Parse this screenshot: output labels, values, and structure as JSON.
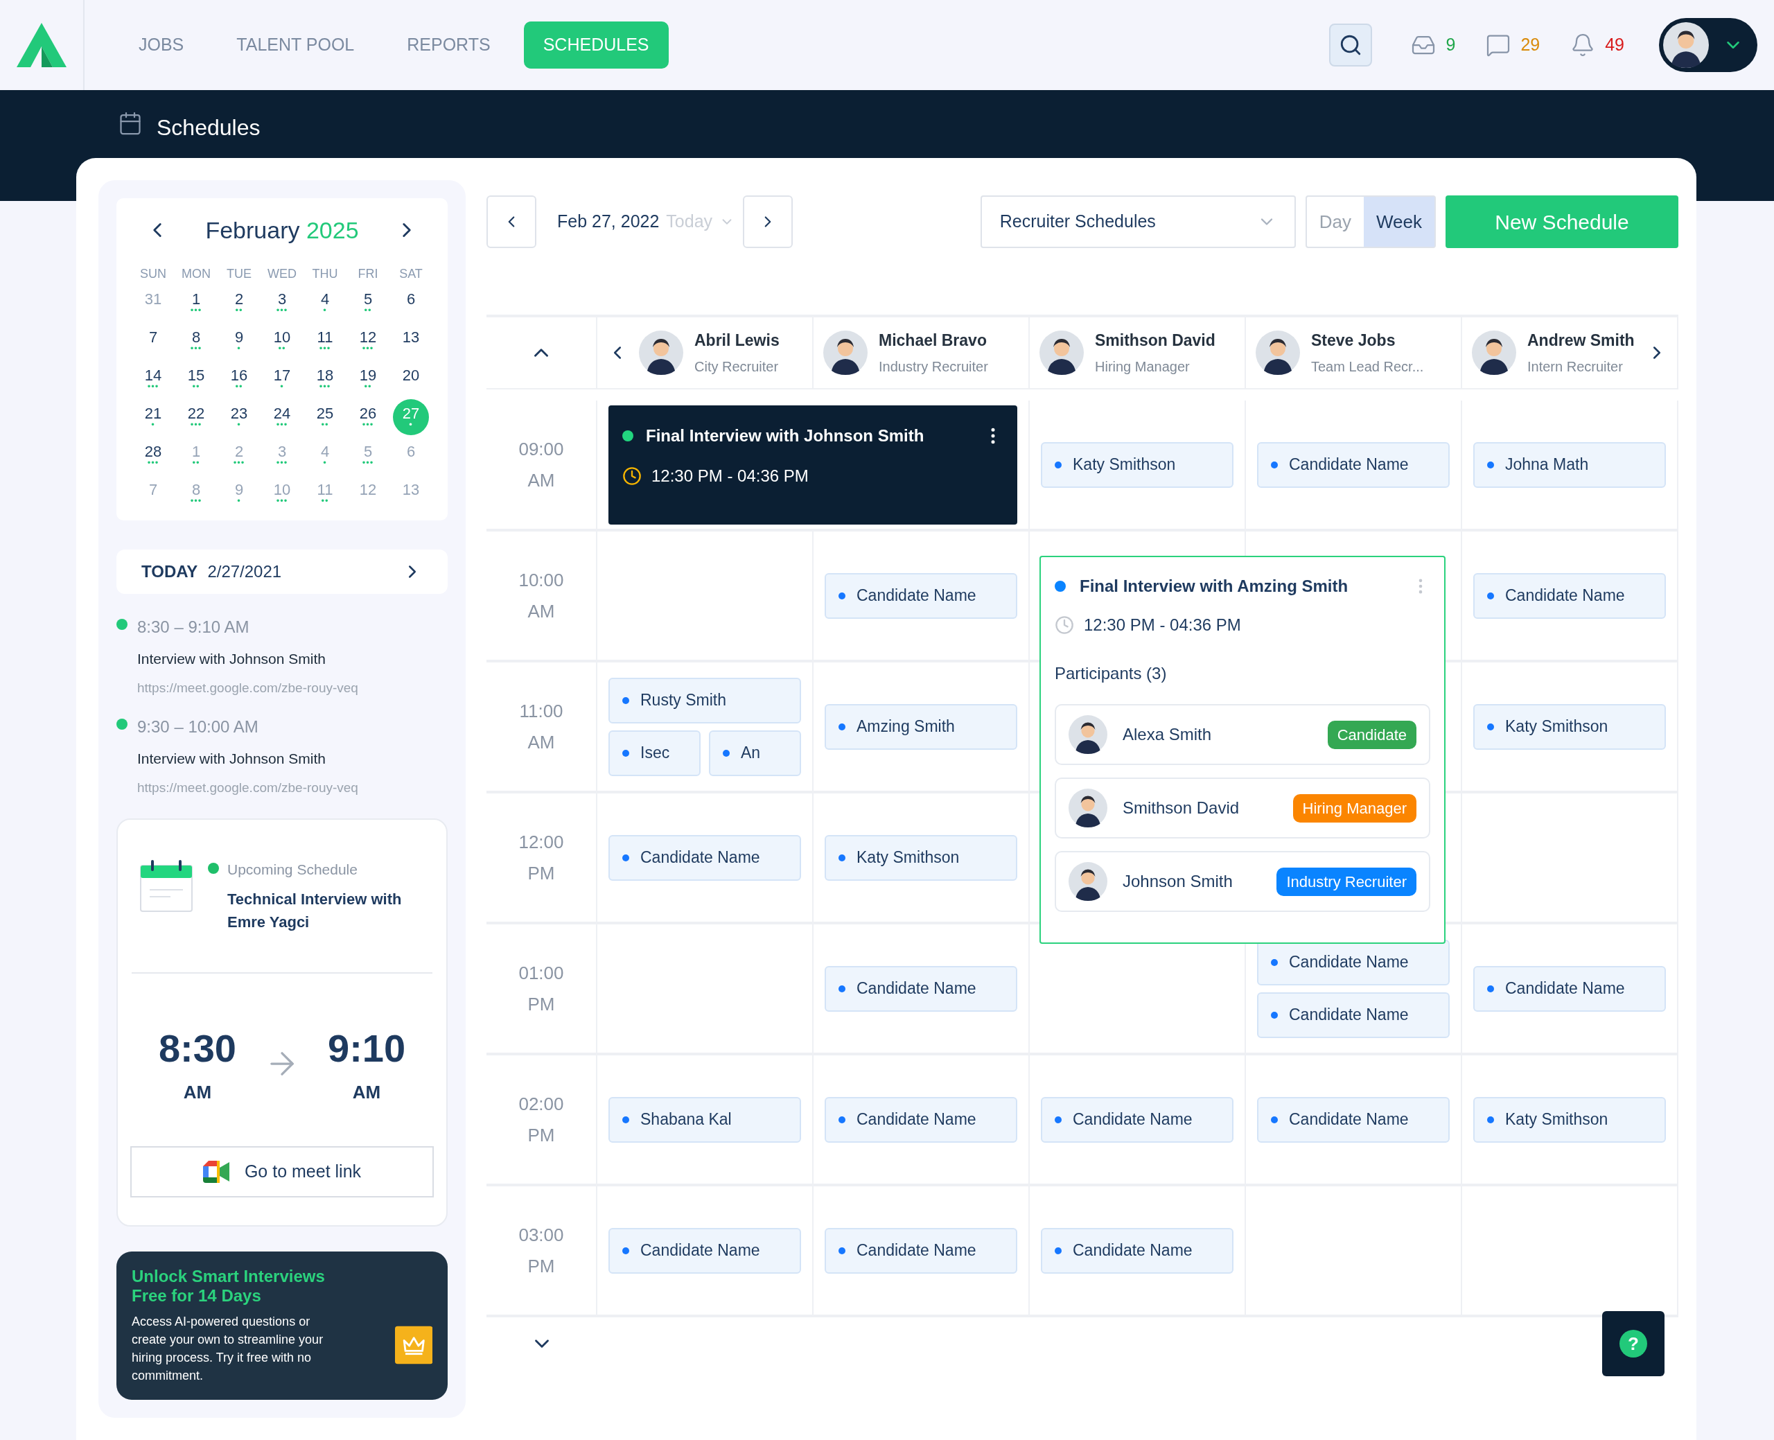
{
  "nav": {
    "items": [
      {
        "label": "JOBS",
        "selected": false
      },
      {
        "label": "TALENT POOL",
        "selected": false
      },
      {
        "label": "REPORTS",
        "selected": false
      },
      {
        "label": "SCHEDULES",
        "selected": true
      }
    ],
    "counters": [
      {
        "kind": "inbox",
        "count": "9",
        "color": "#1fa64a"
      },
      {
        "kind": "chat",
        "count": "29",
        "color": "#d98b0a"
      },
      {
        "kind": "bell",
        "count": "49",
        "color": "#d81b1b"
      }
    ]
  },
  "page_title": "Schedules",
  "mini_calendar": {
    "month": "February",
    "year": "2025",
    "weekdays": [
      "SUN",
      "MON",
      "TUE",
      "WED",
      "THU",
      "FRI",
      "SAT"
    ],
    "weeks": [
      [
        {
          "day": "31",
          "muted": true,
          "selected": false
        },
        {
          "day": "1",
          "muted": false,
          "selected": false,
          "dots": "•••"
        },
        {
          "day": "2",
          "muted": false,
          "selected": false,
          "dots": "••"
        },
        {
          "day": "3",
          "muted": false,
          "selected": false,
          "dots": "•••"
        },
        {
          "day": "4",
          "muted": false,
          "selected": false,
          "dots": "•"
        },
        {
          "day": "5",
          "muted": false,
          "selected": false,
          "dots": "••"
        },
        {
          "day": "6",
          "muted": false,
          "selected": false
        }
      ],
      [
        {
          "day": "7",
          "muted": false,
          "selected": false
        },
        {
          "day": "8",
          "muted": false,
          "selected": false,
          "dots": "•••"
        },
        {
          "day": "9",
          "muted": false,
          "selected": false,
          "dots": "•"
        },
        {
          "day": "10",
          "muted": false,
          "selected": false,
          "dots": "••"
        },
        {
          "day": "11",
          "muted": false,
          "selected": false,
          "dots": "•••"
        },
        {
          "day": "12",
          "muted": false,
          "selected": false,
          "dots": "•••"
        },
        {
          "day": "13",
          "muted": false,
          "selected": false
        }
      ],
      [
        {
          "day": "14",
          "muted": false,
          "selected": false,
          "dots": "•••"
        },
        {
          "day": "15",
          "muted": false,
          "selected": false,
          "dots": "••"
        },
        {
          "day": "16",
          "muted": false,
          "selected": false,
          "dots": "••"
        },
        {
          "day": "17",
          "muted": false,
          "selected": false,
          "dots": "•"
        },
        {
          "day": "18",
          "muted": false,
          "selected": false,
          "dots": "•••"
        },
        {
          "day": "19",
          "muted": false,
          "selected": false,
          "dots": "••"
        },
        {
          "day": "20",
          "muted": false,
          "selected": false
        }
      ],
      [
        {
          "day": "21",
          "muted": false,
          "selected": false,
          "dots": "•"
        },
        {
          "day": "22",
          "muted": false,
          "selected": false,
          "dots": "•••"
        },
        {
          "day": "23",
          "muted": false,
          "selected": false,
          "dots": "•"
        },
        {
          "day": "24",
          "muted": false,
          "selected": false,
          "dots": "•••"
        },
        {
          "day": "25",
          "muted": false,
          "selected": false,
          "dots": "••"
        },
        {
          "day": "26",
          "muted": false,
          "selected": false,
          "dots": "•••"
        },
        {
          "day": "27",
          "muted": false,
          "selected": true,
          "dots": "•"
        }
      ],
      [
        {
          "day": "28",
          "muted": false,
          "selected": false,
          "dots": "•••"
        },
        {
          "day": "1",
          "muted": true,
          "selected": false,
          "dots": "••"
        },
        {
          "day": "2",
          "muted": true,
          "selected": false,
          "dots": "•••"
        },
        {
          "day": "3",
          "muted": true,
          "selected": false,
          "dots": "•••"
        },
        {
          "day": "4",
          "muted": true,
          "selected": false,
          "dots": "•"
        },
        {
          "day": "5",
          "muted": true,
          "selected": false,
          "dots": "•••"
        },
        {
          "day": "6",
          "muted": true,
          "selected": false
        }
      ],
      [
        {
          "day": "7",
          "muted": true,
          "selected": false
        },
        {
          "day": "8",
          "muted": true,
          "selected": false,
          "dots": "•••"
        },
        {
          "day": "9",
          "muted": true,
          "selected": false,
          "dots": "•"
        },
        {
          "day": "10",
          "muted": true,
          "selected": false,
          "dots": "•••"
        },
        {
          "day": "11",
          "muted": true,
          "selected": false,
          "dots": "••"
        },
        {
          "day": "12",
          "muted": true,
          "selected": false
        },
        {
          "day": "13",
          "muted": true,
          "selected": false
        }
      ]
    ]
  },
  "today_bar": {
    "label": "TODAY",
    "date": "2/27/2021"
  },
  "agenda": [
    {
      "time": "8:30 – 9:10 AM",
      "title": "Interview with Johnson Smith",
      "link": "https://meet.google.com/zbe-rouy-veq"
    },
    {
      "time": "9:30 – 10:00 AM",
      "title": "Interview with Johnson Smith",
      "link": "https://meet.google.com/zbe-rouy-veq"
    }
  ],
  "upcoming": {
    "label": "Upcoming Schedule",
    "title_lines": [
      "Technical Interview with",
      "Emre Yagci"
    ],
    "start": {
      "time": "8:30",
      "period": "AM"
    },
    "end": {
      "time": "9:10",
      "period": "AM"
    },
    "button": "Go to meet link"
  },
  "promo": {
    "title_lines": [
      "Unlock Smart Interviews",
      "Free for 14 Days"
    ],
    "text": "Access AI-powered questions or create your own to streamline your hiring process. Try it free with no commitment."
  },
  "toolbar": {
    "date": "Feb 27, 2022",
    "today": "Today",
    "view_select": "Recruiter Schedules",
    "views": [
      {
        "label": "Day",
        "selected": false
      },
      {
        "label": "Week",
        "selected": true
      }
    ],
    "new_button": "New Schedule"
  },
  "hours": [
    {
      "time": "09:00",
      "period": "AM"
    },
    {
      "time": "10:00",
      "period": "AM"
    },
    {
      "time": "11:00",
      "period": "AM"
    },
    {
      "time": "12:00",
      "period": "PM"
    },
    {
      "time": "01:00",
      "period": "PM"
    },
    {
      "time": "02:00",
      "period": "PM"
    },
    {
      "time": "03:00",
      "period": "PM"
    }
  ],
  "recruiters": [
    {
      "name": "Abril Lewis",
      "role": "City Recruiter",
      "slots": [
        {
          "kind": "booked",
          "events": [
            {
              "kind": "highlight",
              "title": "Final Interview with Johnson Smith",
              "time": "12:30 PM - 04:36 PM"
            }
          ]
        },
        {
          "kind": "free"
        },
        {
          "kind": "booked",
          "events": [
            {
              "kind": "chip",
              "name": "Rusty Smith"
            },
            {
              "kind": "pair",
              "items": [
                {
                  "name": "Isec"
                },
                {
                  "name": "An"
                }
              ]
            }
          ]
        },
        {
          "kind": "booked",
          "events": [
            {
              "kind": "chip",
              "name": "Candidate Name"
            }
          ]
        },
        {
          "kind": "free"
        },
        {
          "kind": "booked",
          "events": [
            {
              "kind": "chip",
              "name": "Shabana Kal"
            }
          ]
        },
        {
          "kind": "booked",
          "events": [
            {
              "kind": "chip",
              "name": "Candidate Name"
            }
          ]
        }
      ]
    },
    {
      "name": "Michael Bravo",
      "role": "Industry Recruiter",
      "slots": [
        {
          "kind": "covered"
        },
        {
          "kind": "booked",
          "events": [
            {
              "kind": "chip",
              "name": "Candidate Name"
            }
          ]
        },
        {
          "kind": "booked",
          "events": [
            {
              "kind": "chip",
              "name": "Amzing Smith"
            }
          ]
        },
        {
          "kind": "booked",
          "events": [
            {
              "kind": "chip",
              "name": "Katy Smithson"
            }
          ]
        },
        {
          "kind": "booked",
          "events": [
            {
              "kind": "chip",
              "name": "Candidate Name"
            }
          ]
        },
        {
          "kind": "booked",
          "events": [
            {
              "kind": "chip",
              "name": "Candidate Name"
            }
          ]
        },
        {
          "kind": "booked",
          "events": [
            {
              "kind": "chip",
              "name": "Candidate Name"
            }
          ]
        }
      ]
    },
    {
      "name": "Smithson David",
      "role": "Hiring Manager",
      "slots": [
        {
          "kind": "booked",
          "events": [
            {
              "kind": "chip",
              "name": "Katy Smithson"
            }
          ]
        },
        {
          "kind": "booked",
          "events": [
            {
              "kind": "popup",
              "title": "Final Interview with Amzing Smith",
              "time": "12:30 PM - 04:36 PM",
              "participants_label": "Participants (3)",
              "participants": [
                {
                  "name": "Alexa Smith",
                  "role": "Candidate",
                  "color": "#34a853"
                },
                {
                  "name": "Smithson David",
                  "role": "Hiring Manager",
                  "color": "#fb8500"
                },
                {
                  "name": "Johnson Smith",
                  "role": "Industry Recruiter",
                  "color": "#0a84ff"
                }
              ]
            }
          ]
        },
        {
          "kind": "free"
        },
        {
          "kind": "free"
        },
        {
          "kind": "free"
        },
        {
          "kind": "booked",
          "events": [
            {
              "kind": "chip",
              "name": "Candidate Name"
            }
          ]
        },
        {
          "kind": "booked",
          "events": [
            {
              "kind": "chip",
              "name": "Candidate Name"
            }
          ]
        }
      ]
    },
    {
      "name": "Steve Jobs",
      "role": "Team Lead Recr...",
      "slots": [
        {
          "kind": "booked",
          "events": [
            {
              "kind": "chip",
              "name": "Candidate Name"
            }
          ]
        },
        {
          "kind": "free"
        },
        {
          "kind": "free"
        },
        {
          "kind": "free"
        },
        {
          "kind": "booked",
          "events": [
            {
              "kind": "chip",
              "name": "Candidate Name"
            },
            {
              "kind": "chip",
              "name": "Candidate Name"
            }
          ]
        },
        {
          "kind": "booked",
          "events": [
            {
              "kind": "chip",
              "name": "Candidate Name"
            }
          ]
        },
        {
          "kind": "free"
        }
      ]
    },
    {
      "name": "Andrew Smith",
      "role": "Intern Recruiter",
      "slots": [
        {
          "kind": "booked",
          "events": [
            {
              "kind": "chip",
              "name": "Johna Math"
            }
          ]
        },
        {
          "kind": "booked",
          "events": [
            {
              "kind": "chip",
              "name": "Candidate Name"
            }
          ]
        },
        {
          "kind": "booked",
          "events": [
            {
              "kind": "chip",
              "name": "Katy Smithson"
            }
          ]
        },
        {
          "kind": "free"
        },
        {
          "kind": "booked",
          "events": [
            {
              "kind": "chip",
              "name": "Candidate Name"
            }
          ]
        },
        {
          "kind": "booked",
          "events": [
            {
              "kind": "chip",
              "name": "Katy Smithson"
            }
          ]
        },
        {
          "kind": "free"
        }
      ]
    }
  ],
  "help_button": "?"
}
